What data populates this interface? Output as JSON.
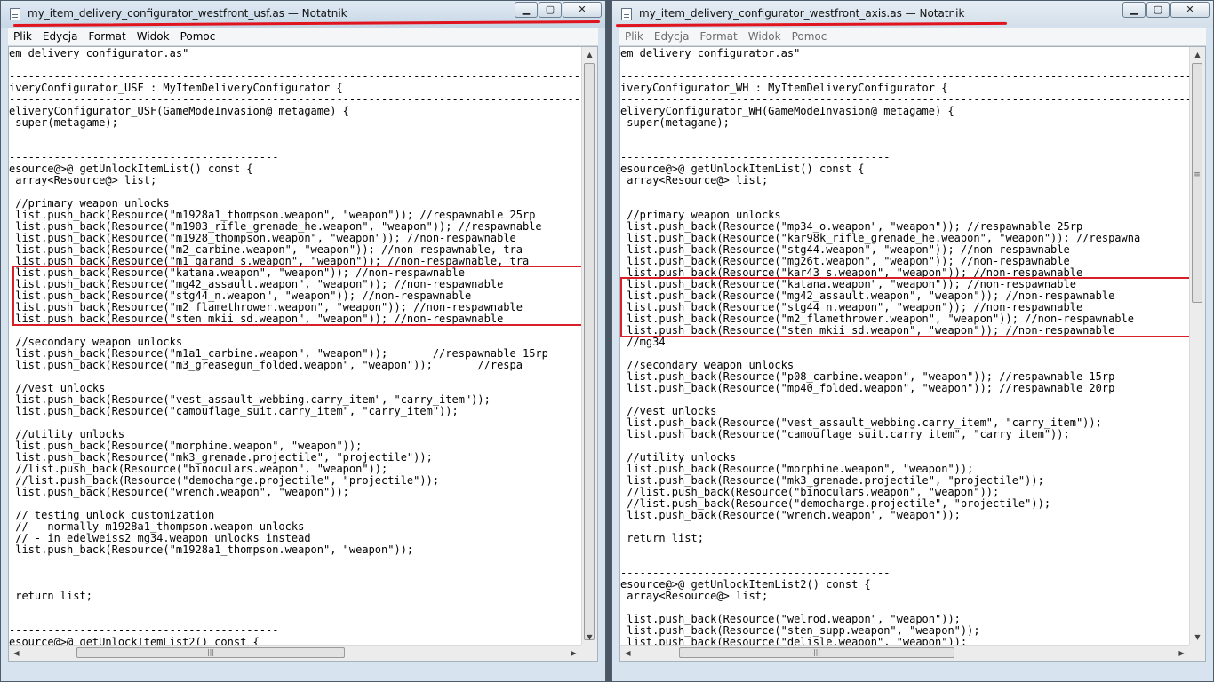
{
  "left_window": {
    "title": "my_item_delivery_configurator_westfront_usf.as — Notatnik",
    "controls": [
      "▁",
      "▢",
      "✕"
    ],
    "menu": [
      "Plik",
      "Edycja",
      "Format",
      "Widok",
      "Pomoc"
    ],
    "lines": [
      "em_delivery_configurator.as\"",
      "",
      "--------------------------------------------------------------------------------------------",
      "iveryConfigurator_USF : MyItemDeliveryConfigurator {",
      "--------------------------------------------------------------------------------------------",
      "eliveryConfigurator_USF(GameModeInvasion@ metagame) {",
      " super(metagame);",
      "",
      "",
      "------------------------------------------",
      "esource@>@ getUnlockItemList() const {",
      " array<Resource@> list;",
      "",
      " //primary weapon unlocks",
      " list.push_back(Resource(\"m1928a1_thompson.weapon\", \"weapon\")); //respawnable 25rp",
      " list.push_back(Resource(\"m1903_rifle_grenade_he.weapon\", \"weapon\")); //respawnable",
      " list.push_back(Resource(\"m1928_thompson.weapon\", \"weapon\")); //non-respawnable",
      " list.push_back(Resource(\"m2_carbine.weapon\", \"weapon\")); //non-respawnable, tra",
      " list.push_back(Resource(\"m1_garand_s.weapon\", \"weapon\")); //non-respawnable, tra",
      " list.push_back(Resource(\"katana.weapon\", \"weapon\")); //non-respawnable",
      " list.push_back(Resource(\"mg42_assault.weapon\", \"weapon\")); //non-respawnable",
      " list.push_back(Resource(\"stg44_n.weapon\", \"weapon\")); //non-respawnable",
      " list.push_back(Resource(\"m2_flamethrower.weapon\", \"weapon\")); //non-respawnable",
      " list.push_back(Resource(\"sten_mkii_sd.weapon\", \"weapon\")); //non-respawnable",
      "",
      " //secondary weapon unlocks",
      " list.push_back(Resource(\"m1a1_carbine.weapon\", \"weapon\"));       //respawnable 15rp",
      " list.push_back(Resource(\"m3_greasegun_folded.weapon\", \"weapon\"));       //respa",
      "",
      " //vest unlocks",
      " list.push_back(Resource(\"vest_assault_webbing.carry_item\", \"carry_item\"));",
      " list.push_back(Resource(\"camouflage_suit.carry_item\", \"carry_item\"));",
      "",
      " //utility unlocks",
      " list.push_back(Resource(\"morphine.weapon\", \"weapon\"));",
      " list.push_back(Resource(\"mk3_grenade.projectile\", \"projectile\"));",
      " //list.push_back(Resource(\"binoculars.weapon\", \"weapon\"));",
      " //list.push_back(Resource(\"democharge.projectile\", \"projectile\"));",
      " list.push_back(Resource(\"wrench.weapon\", \"weapon\"));",
      "",
      " // testing unlock customization",
      " // - normally m1928a1_thompson.weapon unlocks",
      " // - in edelweiss2 mg34.weapon unlocks instead",
      " list.push_back(Resource(\"m1928a1_thompson.weapon\", \"weapon\"));",
      "",
      "",
      "",
      " return list;",
      "",
      "",
      "------------------------------------------",
      "esource@>@ getUnlockItemList2() const {"
    ]
  },
  "right_window": {
    "title": "my_item_delivery_configurator_westfront_axis.as — Notatnik",
    "controls": [
      "▁",
      "▢",
      "✕"
    ],
    "menu": [
      "Plik",
      "Edycja",
      "Format",
      "Widok",
      "Pomoc"
    ],
    "lines": [
      "em_delivery_configurator.as\"",
      "",
      "--------------------------------------------------------------------------------------------",
      "iveryConfigurator_WH : MyItemDeliveryConfigurator {",
      "--------------------------------------------------------------------------------------------",
      "eliveryConfigurator_WH(GameModeInvasion@ metagame) {",
      " super(metagame);",
      "",
      "",
      "------------------------------------------",
      "esource@>@ getUnlockItemList() const {",
      " array<Resource@> list;",
      "",
      "",
      " //primary weapon unlocks",
      " list.push_back(Resource(\"mp34_o.weapon\", \"weapon\")); //respawnable 25rp",
      " list.push_back(Resource(\"kar98k_rifle_grenade_he.weapon\", \"weapon\")); //respawna",
      " list.push_back(Resource(\"stg44.weapon\", \"weapon\")); //non-respawnable",
      " list.push_back(Resource(\"mg26t.weapon\", \"weapon\")); //non-respawnable",
      " list.push_back(Resource(\"kar43_s.weapon\", \"weapon\")); //non-respawnable",
      " list.push_back(Resource(\"katana.weapon\", \"weapon\")); //non-respawnable",
      " list.push_back(Resource(\"mg42_assault.weapon\", \"weapon\")); //non-respawnable",
      " list.push_back(Resource(\"stg44_n.weapon\", \"weapon\")); //non-respawnable",
      " list.push_back(Resource(\"m2_flamethrower.weapon\", \"weapon\")); //non-respawnable",
      " list.push_back(Resource(\"sten_mkii_sd.weapon\", \"weapon\")); //non-respawnable",
      " //mg34",
      "",
      " //secondary weapon unlocks",
      " list.push_back(Resource(\"p08_carbine.weapon\", \"weapon\")); //respawnable 15rp",
      " list.push_back(Resource(\"mp40_folded.weapon\", \"weapon\")); //respawnable 20rp",
      "",
      " //vest unlocks",
      " list.push_back(Resource(\"vest_assault_webbing.carry_item\", \"carry_item\"));",
      " list.push_back(Resource(\"camouflage_suit.carry_item\", \"carry_item\"));",
      "",
      " //utility unlocks",
      " list.push_back(Resource(\"morphine.weapon\", \"weapon\"));",
      " list.push_back(Resource(\"mk3_grenade.projectile\", \"projectile\"));",
      " //list.push_back(Resource(\"binoculars.weapon\", \"weapon\"));",
      " //list.push_back(Resource(\"democharge.projectile\", \"projectile\"));",
      " list.push_back(Resource(\"wrench.weapon\", \"weapon\"));",
      "",
      " return list;",
      "",
      "",
      "------------------------------------------",
      "esource@>@ getUnlockItemList2() const {",
      " array<Resource@> list;",
      "",
      " list.push_back(Resource(\"welrod.weapon\", \"weapon\"));",
      " list.push_back(Resource(\"sten_supp.weapon\", \"weapon\"));",
      " list.push_back(Resource(\"delisle.weapon\", \"weapon\"));"
    ]
  },
  "scrollbar_arrows": {
    "up": "▲",
    "down": "▼",
    "left": "◀",
    "right": "▶",
    "grip": "≡",
    "hgrip": "|||"
  },
  "colors": {
    "highlight_box": "#d8202a",
    "title_underline": "#e0141e"
  }
}
